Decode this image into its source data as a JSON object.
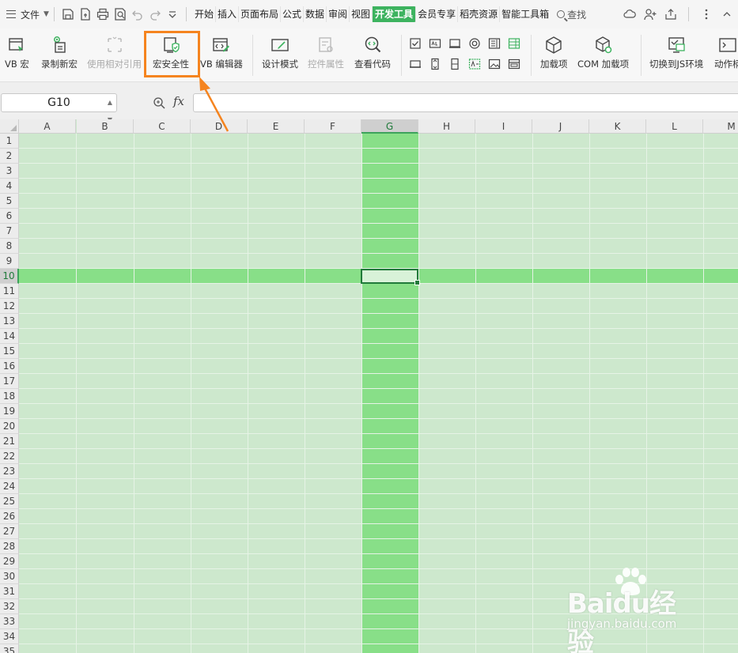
{
  "menubar": {
    "file_label": "文件",
    "tabs": [
      "开始",
      "插入",
      "页面布局",
      "公式",
      "数据",
      "审阅",
      "视图",
      "开发工具",
      "会员专享",
      "稻壳资源",
      "智能工具箱"
    ],
    "active_tab": "开发工具",
    "search_label": "查找"
  },
  "ribbon": {
    "vb_macro": "VB 宏",
    "record_macro": "录制新宏",
    "relative_ref": "使用相对引用",
    "macro_security": "宏安全性",
    "vb_editor": "VB 编辑器",
    "design_mode": "设计模式",
    "control_props": "控件属性",
    "view_code": "查看代码",
    "addins": "加载项",
    "com_addins": "COM 加载项",
    "switch_js": "切换到JS环境",
    "action": "动作柄"
  },
  "formula_bar": {
    "name_box": "G10",
    "fx_label": "fx",
    "formula": ""
  },
  "grid": {
    "columns": [
      "A",
      "B",
      "C",
      "D",
      "E",
      "F",
      "G",
      "H",
      "I",
      "J",
      "K",
      "L",
      "M"
    ],
    "rows": [
      "1",
      "2",
      "3",
      "4",
      "5",
      "6",
      "7",
      "8",
      "9",
      "10",
      "11",
      "12",
      "13",
      "14",
      "15",
      "16",
      "17",
      "18",
      "19",
      "20",
      "21",
      "22",
      "23",
      "24",
      "25",
      "26",
      "27",
      "28",
      "29",
      "30",
      "31",
      "32",
      "33",
      "34",
      "35"
    ],
    "selected_column": "G",
    "selected_row": "10"
  },
  "watermark": {
    "logo": "Baidu经验",
    "url": "jingyan.baidu.com"
  },
  "colors": {
    "accent": "#3db35f",
    "highlight_box": "#f5841f",
    "sheet_bg": "#cde8cd",
    "crosshair": "#88df88"
  }
}
